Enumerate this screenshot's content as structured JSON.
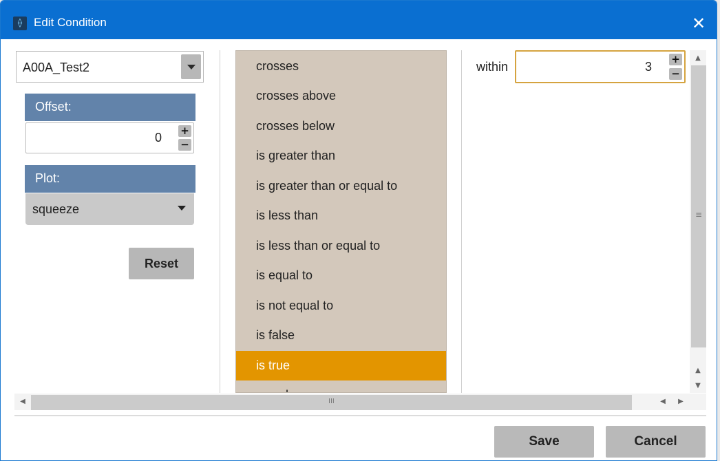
{
  "window": {
    "title": "Edit Condition",
    "app_icon": "app-logo-icon",
    "close_glyph": "✕"
  },
  "left": {
    "series_select": {
      "value": "A00A_Test2"
    },
    "offset": {
      "header": "Offset:",
      "value": "0",
      "plus": "+",
      "minus": "−"
    },
    "plot": {
      "header": "Plot:",
      "value": "squeeze"
    },
    "reset_label": "Reset"
  },
  "operators": {
    "items": [
      "crosses",
      "crosses above",
      "crosses below",
      "is greater than",
      "is greater than or equal to",
      "is less than",
      "is less than or equal to",
      "is equal to",
      "is not equal to",
      "is false",
      "is true",
      "as value"
    ],
    "selected": "is true",
    "selected_color": "#e39500",
    "list_color": "#d3c8bb"
  },
  "right": {
    "within_label": "within",
    "within_value": "3",
    "plus": "+",
    "minus": "−"
  },
  "scrollbars": {
    "v_grip": "≡",
    "h_grip": "III",
    "up": "▲",
    "down": "▼",
    "left": "◀",
    "right": "▶"
  },
  "footer": {
    "save_label": "Save",
    "cancel_label": "Cancel"
  },
  "colors": {
    "titlebar": "#0a6fd1",
    "section_header": "#6283aa",
    "within_border": "#d5a33f"
  }
}
